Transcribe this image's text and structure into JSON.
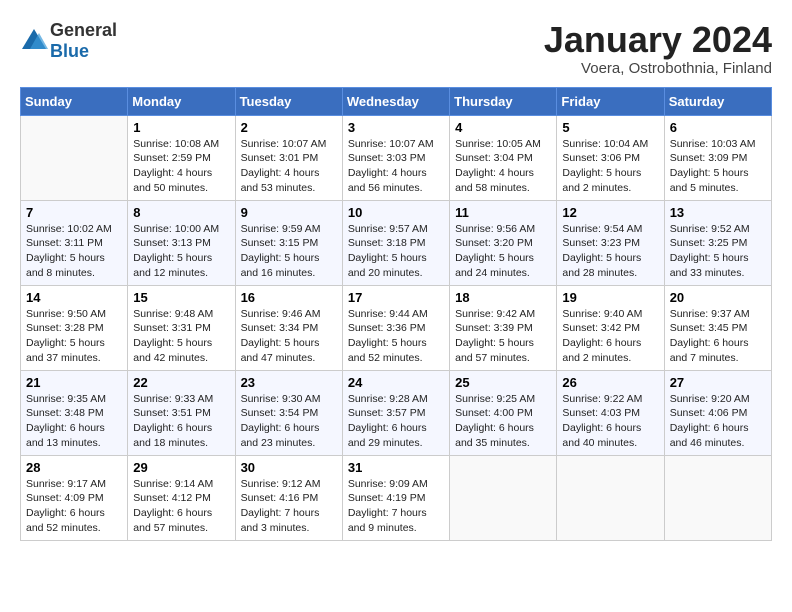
{
  "header": {
    "logo_general": "General",
    "logo_blue": "Blue",
    "month": "January 2024",
    "location": "Voera, Ostrobothnia, Finland"
  },
  "weekdays": [
    "Sunday",
    "Monday",
    "Tuesday",
    "Wednesday",
    "Thursday",
    "Friday",
    "Saturday"
  ],
  "weeks": [
    [
      {
        "day": "",
        "info": ""
      },
      {
        "day": "1",
        "info": "Sunrise: 10:08 AM\nSunset: 2:59 PM\nDaylight: 4 hours\nand 50 minutes."
      },
      {
        "day": "2",
        "info": "Sunrise: 10:07 AM\nSunset: 3:01 PM\nDaylight: 4 hours\nand 53 minutes."
      },
      {
        "day": "3",
        "info": "Sunrise: 10:07 AM\nSunset: 3:03 PM\nDaylight: 4 hours\nand 56 minutes."
      },
      {
        "day": "4",
        "info": "Sunrise: 10:05 AM\nSunset: 3:04 PM\nDaylight: 4 hours\nand 58 minutes."
      },
      {
        "day": "5",
        "info": "Sunrise: 10:04 AM\nSunset: 3:06 PM\nDaylight: 5 hours\nand 2 minutes."
      },
      {
        "day": "6",
        "info": "Sunrise: 10:03 AM\nSunset: 3:09 PM\nDaylight: 5 hours\nand 5 minutes."
      }
    ],
    [
      {
        "day": "7",
        "info": "Sunrise: 10:02 AM\nSunset: 3:11 PM\nDaylight: 5 hours\nand 8 minutes."
      },
      {
        "day": "8",
        "info": "Sunrise: 10:00 AM\nSunset: 3:13 PM\nDaylight: 5 hours\nand 12 minutes."
      },
      {
        "day": "9",
        "info": "Sunrise: 9:59 AM\nSunset: 3:15 PM\nDaylight: 5 hours\nand 16 minutes."
      },
      {
        "day": "10",
        "info": "Sunrise: 9:57 AM\nSunset: 3:18 PM\nDaylight: 5 hours\nand 20 minutes."
      },
      {
        "day": "11",
        "info": "Sunrise: 9:56 AM\nSunset: 3:20 PM\nDaylight: 5 hours\nand 24 minutes."
      },
      {
        "day": "12",
        "info": "Sunrise: 9:54 AM\nSunset: 3:23 PM\nDaylight: 5 hours\nand 28 minutes."
      },
      {
        "day": "13",
        "info": "Sunrise: 9:52 AM\nSunset: 3:25 PM\nDaylight: 5 hours\nand 33 minutes."
      }
    ],
    [
      {
        "day": "14",
        "info": "Sunrise: 9:50 AM\nSunset: 3:28 PM\nDaylight: 5 hours\nand 37 minutes."
      },
      {
        "day": "15",
        "info": "Sunrise: 9:48 AM\nSunset: 3:31 PM\nDaylight: 5 hours\nand 42 minutes."
      },
      {
        "day": "16",
        "info": "Sunrise: 9:46 AM\nSunset: 3:34 PM\nDaylight: 5 hours\nand 47 minutes."
      },
      {
        "day": "17",
        "info": "Sunrise: 9:44 AM\nSunset: 3:36 PM\nDaylight: 5 hours\nand 52 minutes."
      },
      {
        "day": "18",
        "info": "Sunrise: 9:42 AM\nSunset: 3:39 PM\nDaylight: 5 hours\nand 57 minutes."
      },
      {
        "day": "19",
        "info": "Sunrise: 9:40 AM\nSunset: 3:42 PM\nDaylight: 6 hours\nand 2 minutes."
      },
      {
        "day": "20",
        "info": "Sunrise: 9:37 AM\nSunset: 3:45 PM\nDaylight: 6 hours\nand 7 minutes."
      }
    ],
    [
      {
        "day": "21",
        "info": "Sunrise: 9:35 AM\nSunset: 3:48 PM\nDaylight: 6 hours\nand 13 minutes."
      },
      {
        "day": "22",
        "info": "Sunrise: 9:33 AM\nSunset: 3:51 PM\nDaylight: 6 hours\nand 18 minutes."
      },
      {
        "day": "23",
        "info": "Sunrise: 9:30 AM\nSunset: 3:54 PM\nDaylight: 6 hours\nand 23 minutes."
      },
      {
        "day": "24",
        "info": "Sunrise: 9:28 AM\nSunset: 3:57 PM\nDaylight: 6 hours\nand 29 minutes."
      },
      {
        "day": "25",
        "info": "Sunrise: 9:25 AM\nSunset: 4:00 PM\nDaylight: 6 hours\nand 35 minutes."
      },
      {
        "day": "26",
        "info": "Sunrise: 9:22 AM\nSunset: 4:03 PM\nDaylight: 6 hours\nand 40 minutes."
      },
      {
        "day": "27",
        "info": "Sunrise: 9:20 AM\nSunset: 4:06 PM\nDaylight: 6 hours\nand 46 minutes."
      }
    ],
    [
      {
        "day": "28",
        "info": "Sunrise: 9:17 AM\nSunset: 4:09 PM\nDaylight: 6 hours\nand 52 minutes."
      },
      {
        "day": "29",
        "info": "Sunrise: 9:14 AM\nSunset: 4:12 PM\nDaylight: 6 hours\nand 57 minutes."
      },
      {
        "day": "30",
        "info": "Sunrise: 9:12 AM\nSunset: 4:16 PM\nDaylight: 7 hours\nand 3 minutes."
      },
      {
        "day": "31",
        "info": "Sunrise: 9:09 AM\nSunset: 4:19 PM\nDaylight: 7 hours\nand 9 minutes."
      },
      {
        "day": "",
        "info": ""
      },
      {
        "day": "",
        "info": ""
      },
      {
        "day": "",
        "info": ""
      }
    ]
  ]
}
